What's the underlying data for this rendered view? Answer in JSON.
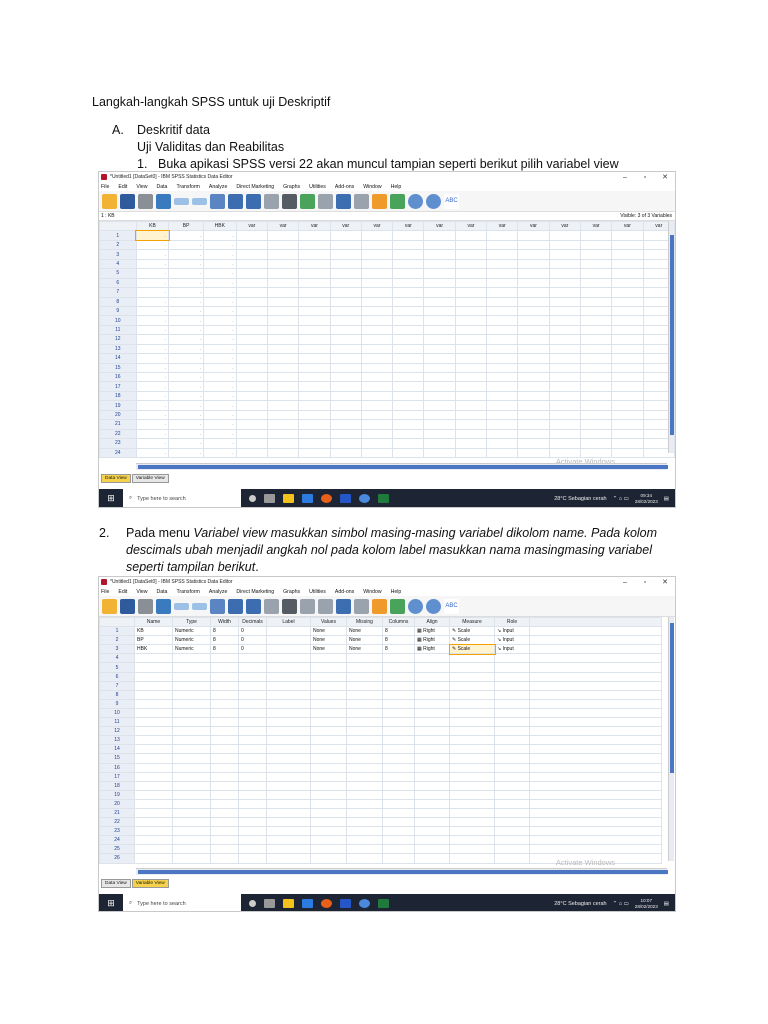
{
  "doc": {
    "heading": "Langkah-langkah SPSS untuk uji Deskriptif",
    "section_a_marker": "A.",
    "section_a_title": "Deskritif data",
    "subtitle": "Uji Validitas dan Reabilitas",
    "step1_marker": "1.",
    "step1_text": "Buka apikasi SPSS versi 22 akan muncul tampian seperti berikut pilih variabel view",
    "step2_marker": "2.",
    "step2_prefix": "Pada menu ",
    "step2_italic": "Variabel view masukkan simbol masing-masing variabel dikolom name. Pada kolom descimals ubah menjadil angkah nol pada kolom label masukkan nama masingmasing variabel seperti tampilan berikut",
    "step2_suffix": "."
  },
  "window": {
    "title": "*Untitled1 [DataSet0] - IBM SPSS Statistics Data Editor",
    "controls": [
      "–",
      "▫",
      "✕"
    ],
    "menu": [
      "File",
      "Edit",
      "View",
      "Data",
      "Transform",
      "Analyze",
      "Direct Marketing",
      "Graphs",
      "Utilities",
      "Add-ons",
      "Window",
      "Help"
    ],
    "tabs": [
      "Data View",
      "Variable View"
    ],
    "activate": "Activate Windows"
  },
  "data_view": {
    "cell_ref": "1 : KB",
    "visible": "Visible: 3 of 3 Variables",
    "columns": [
      "KB",
      "BP",
      "HBK",
      "var",
      "var",
      "var",
      "var",
      "var",
      "var",
      "var",
      "var",
      "var",
      "var",
      "var",
      "var",
      "var",
      "var"
    ],
    "row_numbers": [
      "1",
      "2",
      "3",
      "4",
      "5",
      "6",
      "7",
      "8",
      "9",
      "10",
      "11",
      "12",
      "13",
      "14",
      "15",
      "16",
      "17",
      "18",
      "19",
      "20",
      "21",
      "22",
      "23",
      "24"
    ],
    "empty_marker": "."
  },
  "variable_view": {
    "columns": [
      "Name",
      "Type",
      "Width",
      "Decimals",
      "Label",
      "Values",
      "Missing",
      "Columns",
      "Align",
      "Measure",
      "Role"
    ],
    "rows": [
      [
        "KB",
        "Numeric",
        "8",
        "0",
        "",
        "None",
        "None",
        "8",
        "Right",
        "Scale",
        "Input"
      ],
      [
        "BP",
        "Numeric",
        "8",
        "0",
        "",
        "None",
        "None",
        "8",
        "Right",
        "Scale",
        "Input"
      ],
      [
        "HBK",
        "Numeric",
        "8",
        "0",
        "",
        "None",
        "None",
        "8",
        "Right",
        "Scale",
        "Input"
      ]
    ],
    "row_numbers": [
      "1",
      "2",
      "3",
      "4",
      "5",
      "6",
      "7",
      "8",
      "9",
      "10",
      "11",
      "12",
      "13",
      "14",
      "15",
      "16",
      "17",
      "18",
      "19",
      "20",
      "21",
      "22",
      "23",
      "24",
      "25",
      "26"
    ]
  },
  "taskbar1": {
    "search_placeholder": "Type here to search",
    "weather": "28°C  Sebagian cerah",
    "time": "09:34",
    "date": "28/02/2023"
  },
  "taskbar2": {
    "search_placeholder": "Type here to search",
    "weather": "28°C  Sebagian cerah",
    "time": "10:07",
    "date": "28/02/2023"
  },
  "colors": {
    "accent": "#4a76c4",
    "taskbar": "#1d2433",
    "active_tab": "#f6d24a"
  }
}
